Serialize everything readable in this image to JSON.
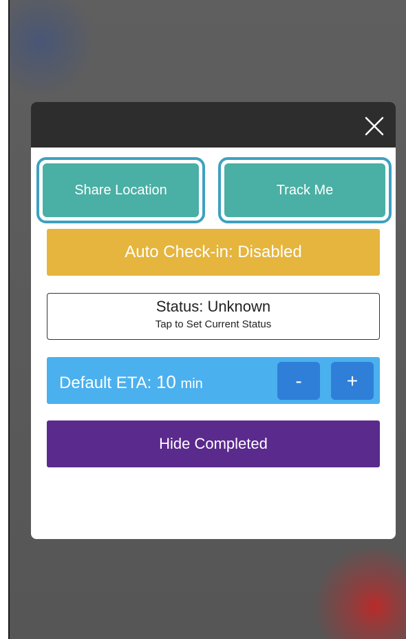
{
  "modal": {
    "close_icon": "close-icon",
    "share_location_label": "Share Location",
    "track_me_label": "Track Me",
    "auto_checkin_label": "Auto Check-in: Disabled",
    "status": {
      "title": "Status: Unknown",
      "subtitle": "Tap to Set Current Status"
    },
    "eta": {
      "label": "Default ETA:",
      "value": "10",
      "unit": "min",
      "minus_label": "-",
      "plus_label": "+"
    },
    "hide_completed_label": "Hide Completed"
  },
  "colors": {
    "header": "#2d2d2d",
    "teal_button": "#4aafa4",
    "highlight_outline": "#3da1c0",
    "auto_checkin": "#e5b53e",
    "eta_bar": "#4bb0ee",
    "eta_buttons": "#2f7fd8",
    "hide_completed": "#5b2a8d"
  }
}
